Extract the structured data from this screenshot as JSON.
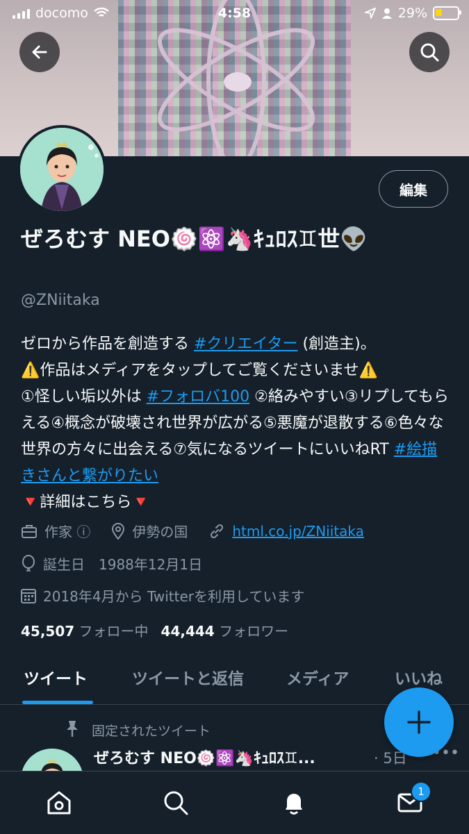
{
  "status_bar": {
    "carrier": "docomo",
    "time": "4:58",
    "battery": "29%"
  },
  "header": {
    "back_icon": "back-arrow-icon",
    "search_icon": "search-icon"
  },
  "profile": {
    "edit_label": "編集",
    "name": "ぜろむす NEO🍥⚛️🦄ｷｭﾛｽ♊世👽",
    "handle": "@ZNiitaka",
    "bio": {
      "line1_pre": "ゼロから作品を創造する ",
      "line1_tag": "#クリエイター",
      "line1_post": " (創造主)。",
      "line2": "⚠️作品はメディアをタップしてご覧くださいませ⚠️",
      "line3_pre": "①怪しい垢以外は ",
      "line3_tag": "#フォロバ100",
      "line3_post": " ②絡みやすい③リプしてもらえる④概念が破壊され世界が広がる⑤悪魔が退散する⑥色々な世界の方々に出会える⑦気になるツイートにいいねRT ",
      "line3_tag2": "#絵描きさんと繋がりたい",
      "line4": "🔻詳細はこちら🔻"
    },
    "category": "作家 ⓘ",
    "location": "伊勢の国",
    "link": "html.co.jp/ZNiitaka",
    "birthday": "誕生日　1988年12月1日",
    "joined": "2018年4月から Twitterを利用しています",
    "following_count": "45,507",
    "following_label": "フォロー中",
    "followers_count": "44,444",
    "followers_label": "フォロワー"
  },
  "tabs": [
    {
      "label": "ツイート",
      "active": true
    },
    {
      "label": "ツイートと返信"
    },
    {
      "label": "メディア"
    },
    {
      "label": "いいね"
    }
  ],
  "pinned_tweet": {
    "pinned_label": "固定されたツイート",
    "name": "ぜろむす NEO🍥⚛️🦄ｷｭﾛｽ♊...",
    "time": "· 5日",
    "more": "•••"
  },
  "bottom_nav": {
    "items": [
      "home-icon",
      "search-icon",
      "notifications-icon",
      "messages-icon"
    ],
    "messages_badge": "1"
  },
  "colors": {
    "background": "#15202b",
    "accent": "#1d9bf0",
    "secondary_text": "#8b98a5"
  }
}
